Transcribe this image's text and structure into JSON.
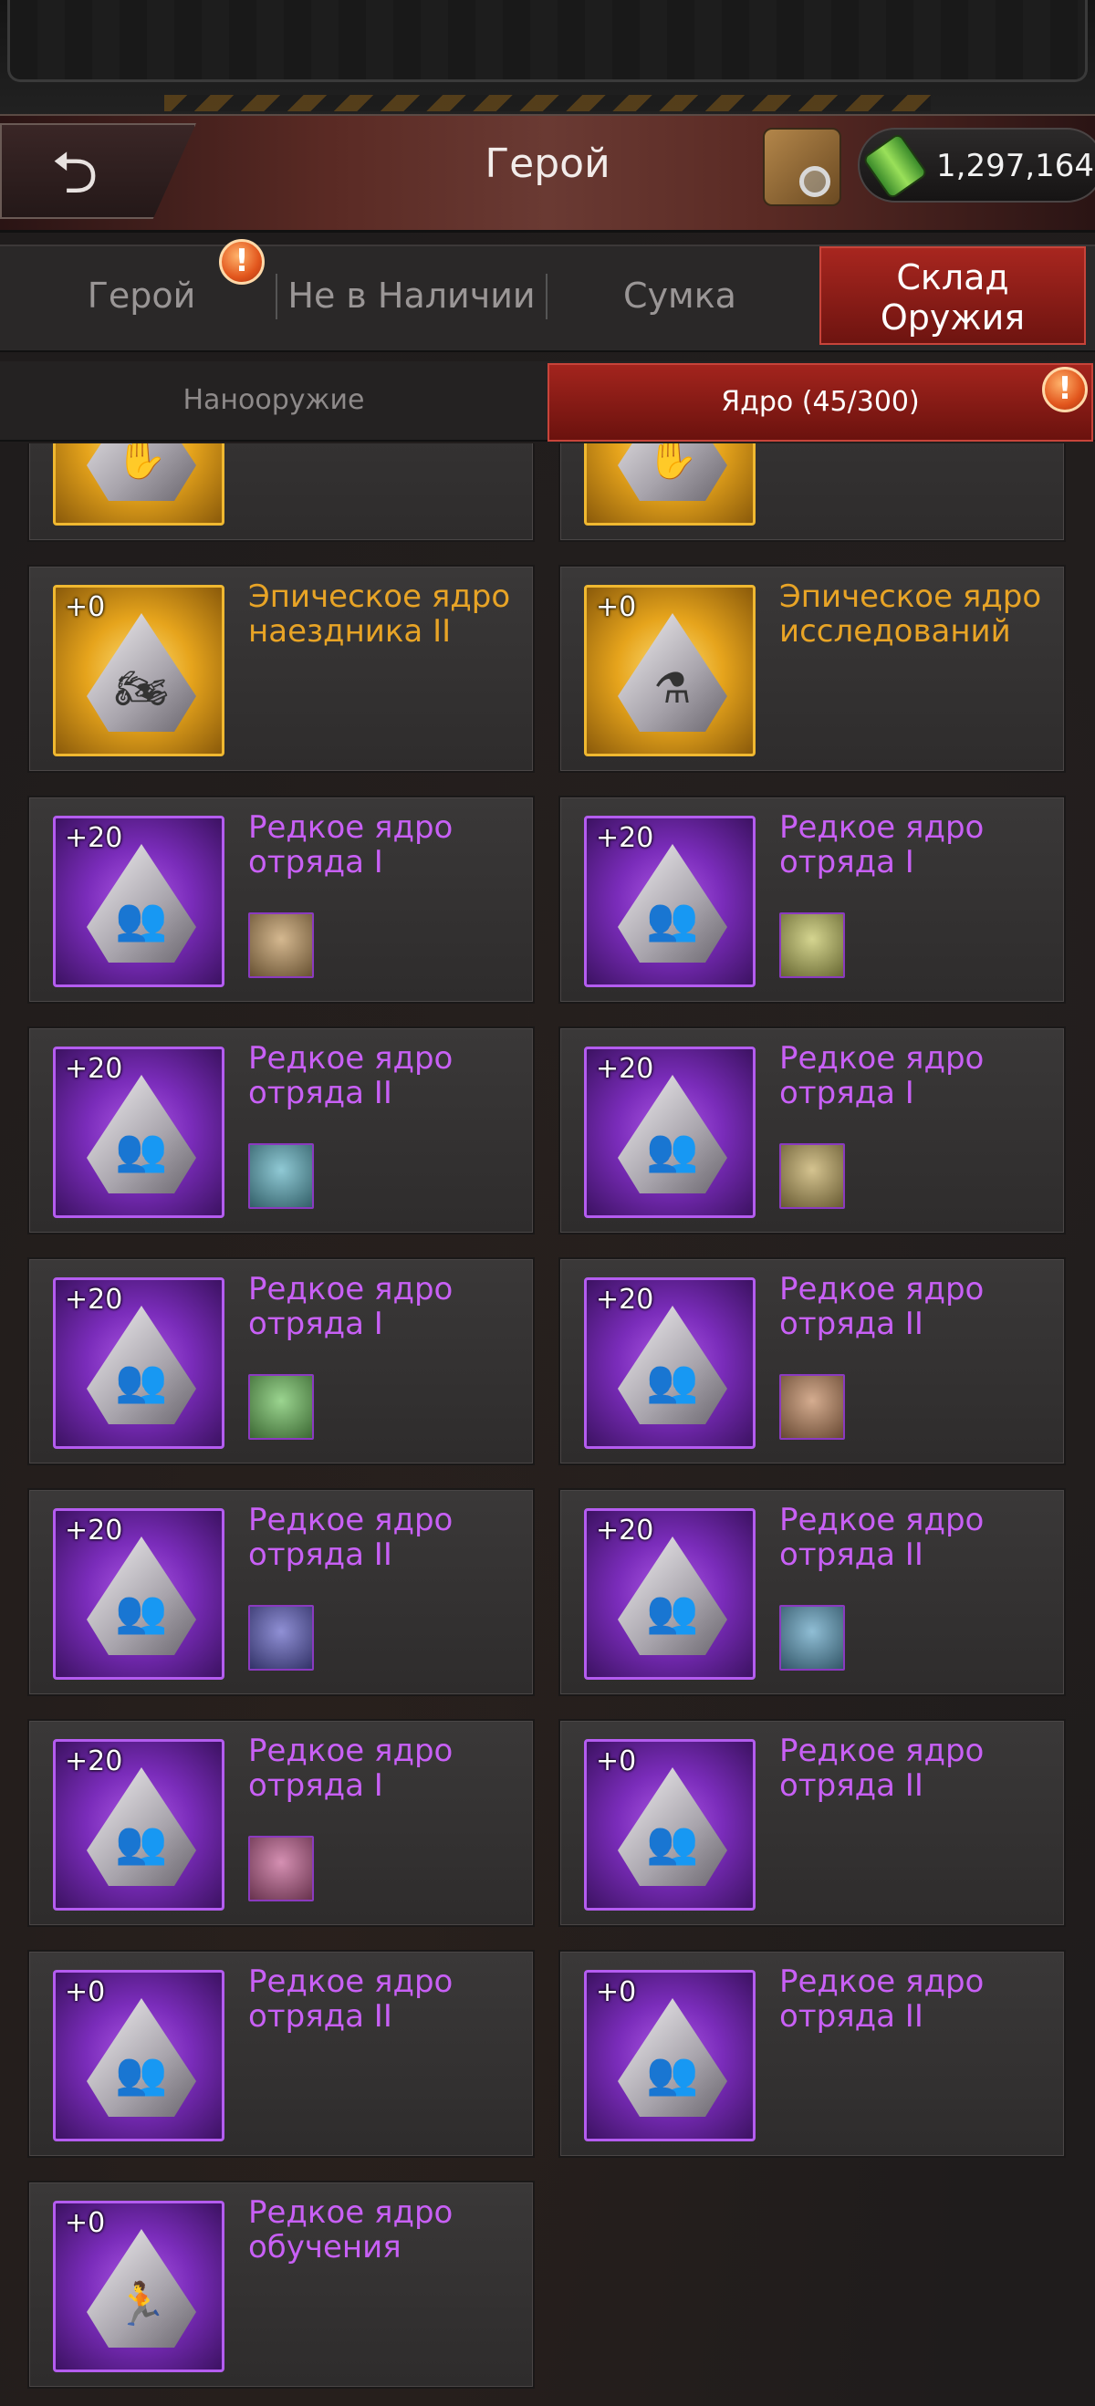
{
  "header": {
    "title": "Герой",
    "resource_amount": "1,297,164"
  },
  "tabs": [
    {
      "label": "Герой"
    },
    {
      "label": "Не в Наличии"
    },
    {
      "label": "Сумка"
    },
    {
      "label": "Склад Оружия"
    }
  ],
  "subtabs": [
    {
      "label": "Нанооружие"
    },
    {
      "label": "Ядро (45/300)"
    }
  ],
  "alert_symbol": "!",
  "cores": [
    {
      "level": "",
      "name": "",
      "rarity": "gold",
      "glyph": "hand-icon"
    },
    {
      "level": "",
      "name": "",
      "rarity": "gold",
      "glyph": "hand-icon"
    },
    {
      "level": "+0",
      "name": "Эпическое ядро наездника II",
      "rarity": "gold",
      "glyph": "rider-icon"
    },
    {
      "level": "+0",
      "name": "Эпическое ядро исследований",
      "rarity": "gold",
      "glyph": "flask-icon"
    },
    {
      "level": "+20",
      "name": "Редкое ядро отряда I",
      "rarity": "purple",
      "glyph": "squad-icon"
    },
    {
      "level": "+20",
      "name": "Редкое ядро отряда I",
      "rarity": "purple",
      "glyph": "squad-icon"
    },
    {
      "level": "+20",
      "name": "Редкое ядро отряда II",
      "rarity": "purple",
      "glyph": "squad-icon"
    },
    {
      "level": "+20",
      "name": "Редкое ядро отряда I",
      "rarity": "purple",
      "glyph": "squad-icon"
    },
    {
      "level": "+20",
      "name": "Редкое ядро отряда I",
      "rarity": "purple",
      "glyph": "squad-icon"
    },
    {
      "level": "+20",
      "name": "Редкое ядро отряда II",
      "rarity": "purple",
      "glyph": "squad-icon"
    },
    {
      "level": "+20",
      "name": "Редкое ядро отряда II",
      "rarity": "purple",
      "glyph": "squad-icon"
    },
    {
      "level": "+20",
      "name": "Редкое ядро отряда II",
      "rarity": "purple",
      "glyph": "squad-icon"
    },
    {
      "level": "+20",
      "name": "Редкое ядро отряда I",
      "rarity": "purple",
      "glyph": "squad-icon"
    },
    {
      "level": "+0",
      "name": "Редкое ядро отряда II",
      "rarity": "purple",
      "glyph": "squad-icon"
    },
    {
      "level": "+0",
      "name": "Редкое ядро отряда II",
      "rarity": "purple",
      "glyph": "squad-icon"
    },
    {
      "level": "+0",
      "name": "Редкое ядро отряда II",
      "rarity": "purple",
      "glyph": "squad-icon"
    },
    {
      "level": "+0",
      "name": "Редкое ядро обучения",
      "rarity": "purple",
      "glyph": "runner-icon"
    }
  ],
  "colors": {
    "accent_red": "#a8261f",
    "rare_purple": "#c860f5",
    "epic_gold": "#e8a426"
  }
}
